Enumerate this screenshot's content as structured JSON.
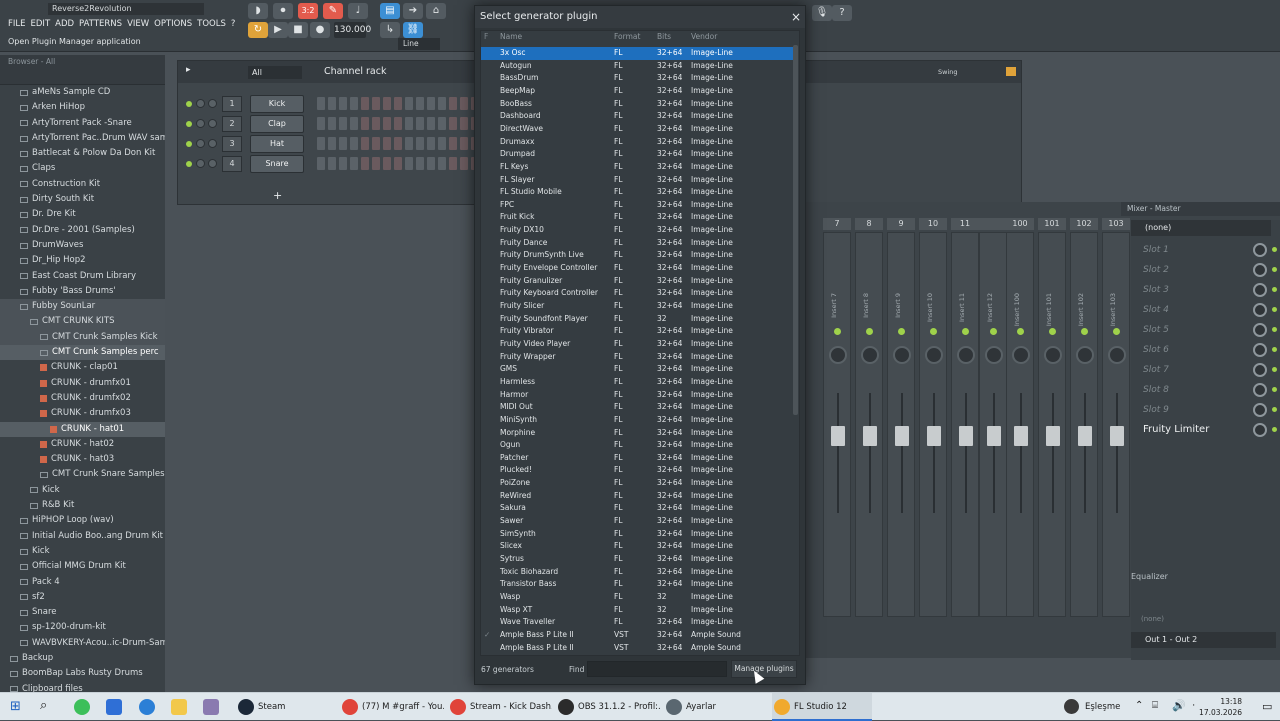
{
  "app": {
    "project_name": "Reverse2Revolution",
    "menu": [
      "FILE",
      "EDIT",
      "ADD",
      "PATTERNS",
      "VIEW",
      "OPTIONS",
      "TOOLS",
      "?"
    ],
    "hint": "Open Plugin Manager application",
    "tempo": "130.000",
    "snap": "Line",
    "pattern_label": "3:2"
  },
  "browser": {
    "header": "Browser - All",
    "items": [
      {
        "label": "aMeNs Sample CD",
        "type": "folder",
        "indent": 1
      },
      {
        "label": "Arken HiHop",
        "type": "folder",
        "indent": 1
      },
      {
        "label": "ArtyTorrent Pack -Snare",
        "type": "folder",
        "indent": 1
      },
      {
        "label": "ArtyTorrent Pac..Drum WAV samples",
        "type": "folder",
        "indent": 1
      },
      {
        "label": "Battlecat & Polow Da Don Kit",
        "type": "folder",
        "indent": 1
      },
      {
        "label": "Claps",
        "type": "folder",
        "indent": 1
      },
      {
        "label": "Construction Kit",
        "type": "folder",
        "indent": 1
      },
      {
        "label": "Dirty South Kit",
        "type": "folder",
        "indent": 1
      },
      {
        "label": "Dr. Dre Kit",
        "type": "folder",
        "indent": 1
      },
      {
        "label": "Dr.Dre - 2001 (Samples)",
        "type": "folder",
        "indent": 1
      },
      {
        "label": "DrumWaves",
        "type": "folder",
        "indent": 1
      },
      {
        "label": "Dr_Hip Hop2",
        "type": "folder",
        "indent": 1
      },
      {
        "label": "East Coast Drum Library",
        "type": "folder",
        "indent": 1
      },
      {
        "label": "Fubby 'Bass Drums'",
        "type": "folder",
        "indent": 1
      },
      {
        "label": "Fubby SounLar",
        "type": "folder",
        "indent": 1,
        "state": "sel"
      },
      {
        "label": "CMT CRUNK KITS",
        "type": "folder",
        "indent": 2,
        "state": "sel"
      },
      {
        "label": "CMT Crunk Samples Kick",
        "type": "folder",
        "indent": 3,
        "state": "sel"
      },
      {
        "label": "CMT Crunk Samples perc",
        "type": "folder",
        "indent": 3,
        "state": "sel2"
      },
      {
        "label": "CRUNK - clap01",
        "type": "file",
        "indent": 3
      },
      {
        "label": "CRUNK - drumfx01",
        "type": "file",
        "indent": 3
      },
      {
        "label": "CRUNK - drumfx02",
        "type": "file",
        "indent": 3
      },
      {
        "label": "CRUNK - drumfx03",
        "type": "file",
        "indent": 3
      },
      {
        "label": "CRUNK - hat01",
        "type": "file",
        "indent": 4,
        "state": "sel2"
      },
      {
        "label": "CRUNK - hat02",
        "type": "file",
        "indent": 3
      },
      {
        "label": "CRUNK - hat03",
        "type": "file",
        "indent": 3
      },
      {
        "label": "CMT Crunk Snare Samples",
        "type": "folder",
        "indent": 3
      },
      {
        "label": "Kick",
        "type": "folder",
        "indent": 2
      },
      {
        "label": "R&B Kit",
        "type": "folder",
        "indent": 2
      },
      {
        "label": "HiPHOP Loop (wav)",
        "type": "folder",
        "indent": 1
      },
      {
        "label": "Initial Audio Boo..ang Drum Kit WiN",
        "type": "folder",
        "indent": 1
      },
      {
        "label": "Kick",
        "type": "folder",
        "indent": 1
      },
      {
        "label": "Official MMG Drum Kit",
        "type": "folder",
        "indent": 1
      },
      {
        "label": "Pack 4",
        "type": "folder",
        "indent": 1
      },
      {
        "label": "sf2",
        "type": "folder",
        "indent": 1
      },
      {
        "label": "Snare",
        "type": "folder",
        "indent": 1
      },
      {
        "label": "sp-1200-drum-kit",
        "type": "folder",
        "indent": 1
      },
      {
        "label": "WAVBVKERY-Acou..ic-Drum-Samples",
        "type": "folder",
        "indent": 1
      },
      {
        "label": "Backup",
        "type": "folder",
        "indent": 0
      },
      {
        "label": "BoomBap Labs Rusty Drums",
        "type": "folder",
        "indent": 0
      },
      {
        "label": "Clipboard files",
        "type": "folder",
        "indent": 0
      }
    ]
  },
  "channel_rack": {
    "filter": "All",
    "title": "Channel rack",
    "swing_label": "Swing",
    "add_label": "+",
    "channels": [
      {
        "num": "1",
        "name": "Kick"
      },
      {
        "num": "2",
        "name": "Clap"
      },
      {
        "num": "3",
        "name": "Hat"
      },
      {
        "num": "4",
        "name": "Snare"
      }
    ]
  },
  "mixer": {
    "title": "Mixer - Master",
    "insert_numbers": [
      "7",
      "8",
      "9",
      "10",
      "11",
      "",
      "100",
      "101",
      "102",
      "103"
    ],
    "insert_labels": [
      "Insert 7",
      "Insert 8",
      "Insert 9",
      "Insert 10",
      "Insert 11",
      "Insert 12",
      "Insert 100",
      "Insert 101",
      "Insert 102",
      "Insert 103"
    ],
    "preset": "(none)",
    "slots": [
      "Slot 1",
      "Slot 2",
      "Slot 3",
      "Slot 4",
      "Slot 5",
      "Slot 6",
      "Slot 7",
      "Slot 8",
      "Slot 9"
    ],
    "active_effect": "Fruity Limiter",
    "equalizer_label": "Equalizer",
    "bottom_preset": "(none)",
    "output": "Out 1 - Out 2"
  },
  "dialog": {
    "title": "Select generator plugin",
    "close": "×",
    "columns": {
      "fav": "F",
      "name": "Name",
      "format": "Format",
      "bits": "Bits",
      "vendor": "Vendor"
    },
    "plugins": [
      {
        "name": "3x Osc",
        "format": "FL",
        "bits": "32+64",
        "vendor": "Image-Line",
        "selected": true
      },
      {
        "name": "Autogun",
        "format": "FL",
        "bits": "32+64",
        "vendor": "Image-Line"
      },
      {
        "name": "BassDrum",
        "format": "FL",
        "bits": "32+64",
        "vendor": "Image-Line"
      },
      {
        "name": "BeepMap",
        "format": "FL",
        "bits": "32+64",
        "vendor": "Image-Line"
      },
      {
        "name": "BooBass",
        "format": "FL",
        "bits": "32+64",
        "vendor": "Image-Line"
      },
      {
        "name": "Dashboard",
        "format": "FL",
        "bits": "32+64",
        "vendor": "Image-Line"
      },
      {
        "name": "DirectWave",
        "format": "FL",
        "bits": "32+64",
        "vendor": "Image-Line"
      },
      {
        "name": "Drumaxx",
        "format": "FL",
        "bits": "32+64",
        "vendor": "Image-Line"
      },
      {
        "name": "Drumpad",
        "format": "FL",
        "bits": "32+64",
        "vendor": "Image-Line"
      },
      {
        "name": "FL Keys",
        "format": "FL",
        "bits": "32+64",
        "vendor": "Image-Line"
      },
      {
        "name": "FL Slayer",
        "format": "FL",
        "bits": "32+64",
        "vendor": "Image-Line"
      },
      {
        "name": "FL Studio Mobile",
        "format": "FL",
        "bits": "32+64",
        "vendor": "Image-Line"
      },
      {
        "name": "FPC",
        "format": "FL",
        "bits": "32+64",
        "vendor": "Image-Line"
      },
      {
        "name": "Fruit Kick",
        "format": "FL",
        "bits": "32+64",
        "vendor": "Image-Line"
      },
      {
        "name": "Fruity DX10",
        "format": "FL",
        "bits": "32+64",
        "vendor": "Image-Line"
      },
      {
        "name": "Fruity Dance",
        "format": "FL",
        "bits": "32+64",
        "vendor": "Image-Line"
      },
      {
        "name": "Fruity DrumSynth Live",
        "format": "FL",
        "bits": "32+64",
        "vendor": "Image-Line"
      },
      {
        "name": "Fruity Envelope Controller",
        "format": "FL",
        "bits": "32+64",
        "vendor": "Image-Line"
      },
      {
        "name": "Fruity Granulizer",
        "format": "FL",
        "bits": "32+64",
        "vendor": "Image-Line"
      },
      {
        "name": "Fruity Keyboard Controller",
        "format": "FL",
        "bits": "32+64",
        "vendor": "Image-Line"
      },
      {
        "name": "Fruity Slicer",
        "format": "FL",
        "bits": "32+64",
        "vendor": "Image-Line"
      },
      {
        "name": "Fruity Soundfont Player",
        "format": "FL",
        "bits": "32",
        "vendor": "Image-Line"
      },
      {
        "name": "Fruity Vibrator",
        "format": "FL",
        "bits": "32+64",
        "vendor": "Image-Line"
      },
      {
        "name": "Fruity Video Player",
        "format": "FL",
        "bits": "32+64",
        "vendor": "Image-Line"
      },
      {
        "name": "Fruity Wrapper",
        "format": "FL",
        "bits": "32+64",
        "vendor": "Image-Line"
      },
      {
        "name": "GMS",
        "format": "FL",
        "bits": "32+64",
        "vendor": "Image-Line"
      },
      {
        "name": "Harmless",
        "format": "FL",
        "bits": "32+64",
        "vendor": "Image-Line"
      },
      {
        "name": "Harmor",
        "format": "FL",
        "bits": "32+64",
        "vendor": "Image-Line"
      },
      {
        "name": "MIDI Out",
        "format": "FL",
        "bits": "32+64",
        "vendor": "Image-Line"
      },
      {
        "name": "MiniSynth",
        "format": "FL",
        "bits": "32+64",
        "vendor": "Image-Line"
      },
      {
        "name": "Morphine",
        "format": "FL",
        "bits": "32+64",
        "vendor": "Image-Line"
      },
      {
        "name": "Ogun",
        "format": "FL",
        "bits": "32+64",
        "vendor": "Image-Line"
      },
      {
        "name": "Patcher",
        "format": "FL",
        "bits": "32+64",
        "vendor": "Image-Line"
      },
      {
        "name": "Plucked!",
        "format": "FL",
        "bits": "32+64",
        "vendor": "Image-Line"
      },
      {
        "name": "PoiZone",
        "format": "FL",
        "bits": "32+64",
        "vendor": "Image-Line"
      },
      {
        "name": "ReWired",
        "format": "FL",
        "bits": "32+64",
        "vendor": "Image-Line"
      },
      {
        "name": "Sakura",
        "format": "FL",
        "bits": "32+64",
        "vendor": "Image-Line"
      },
      {
        "name": "Sawer",
        "format": "FL",
        "bits": "32+64",
        "vendor": "Image-Line"
      },
      {
        "name": "SimSynth",
        "format": "FL",
        "bits": "32+64",
        "vendor": "Image-Line"
      },
      {
        "name": "Slicex",
        "format": "FL",
        "bits": "32+64",
        "vendor": "Image-Line"
      },
      {
        "name": "Sytrus",
        "format": "FL",
        "bits": "32+64",
        "vendor": "Image-Line"
      },
      {
        "name": "Toxic Biohazard",
        "format": "FL",
        "bits": "32+64",
        "vendor": "Image-Line"
      },
      {
        "name": "Transistor Bass",
        "format": "FL",
        "bits": "32+64",
        "vendor": "Image-Line"
      },
      {
        "name": "Wasp",
        "format": "FL",
        "bits": "32",
        "vendor": "Image-Line"
      },
      {
        "name": "Wasp XT",
        "format": "FL",
        "bits": "32",
        "vendor": "Image-Line"
      },
      {
        "name": "Wave Traveller",
        "format": "FL",
        "bits": "32+64",
        "vendor": "Image-Line"
      },
      {
        "name": "Ample Bass P Lite II",
        "format": "VST",
        "bits": "32+64",
        "vendor": "Ample Sound",
        "checked": true
      },
      {
        "name": "Ample Bass P Lite II",
        "format": "VST",
        "bits": "32+64",
        "vendor": "Ample Sound"
      }
    ],
    "count_label": "67 generators",
    "find_label": "Find",
    "manage_label": "Manage plugins"
  },
  "taskbar": {
    "apps": [
      {
        "label": "Steam",
        "color": "#1b2838"
      },
      {
        "label": "(77) M #graff - You...",
        "color": "#e0443a"
      },
      {
        "label": "Stream - Kick Dash...",
        "color": "#e0443a"
      },
      {
        "label": "OBS 31.1.2 - Profil:...",
        "color": "#2b2b2b"
      },
      {
        "label": "Ayarlar",
        "color": "#5a6770"
      },
      {
        "label": "FL Studio 12",
        "color": "#f0a92e",
        "active": true
      }
    ],
    "tray_label": "Eşleşme",
    "time": "13:18",
    "date": "17.03.2026"
  }
}
